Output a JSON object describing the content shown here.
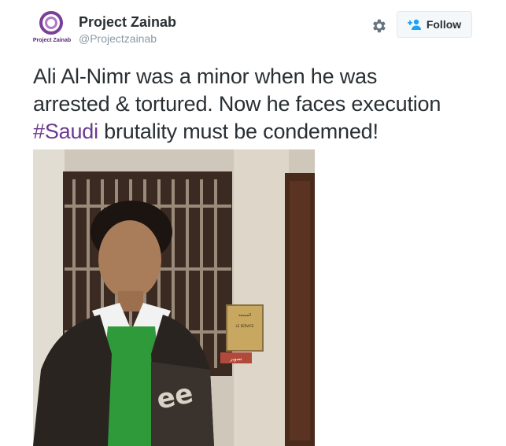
{
  "account": {
    "avatar_brand": "Project Zainab",
    "name": "Project Zainab",
    "handle": "@Projectzainab"
  },
  "actions": {
    "settings_icon": "gear-icon",
    "follow_icon": "add-user-icon",
    "follow_label": "Follow"
  },
  "tweet": {
    "line1": "Ali Al-Nimr was a minor when he was",
    "line2": "arrested & tortured. Now he faces execution",
    "hashtag": "#Saudi",
    "line3_rest": " brutality must be condemned!"
  },
  "photo": {
    "sign_text_1": "المسجد",
    "sign_text_2": "LE SERVICE",
    "sign_text_3": "تصوير"
  },
  "colors": {
    "brand_purple": "#7a3f97",
    "hashtag": "#6b3a8f",
    "follow_icon": "#1da1f2"
  }
}
